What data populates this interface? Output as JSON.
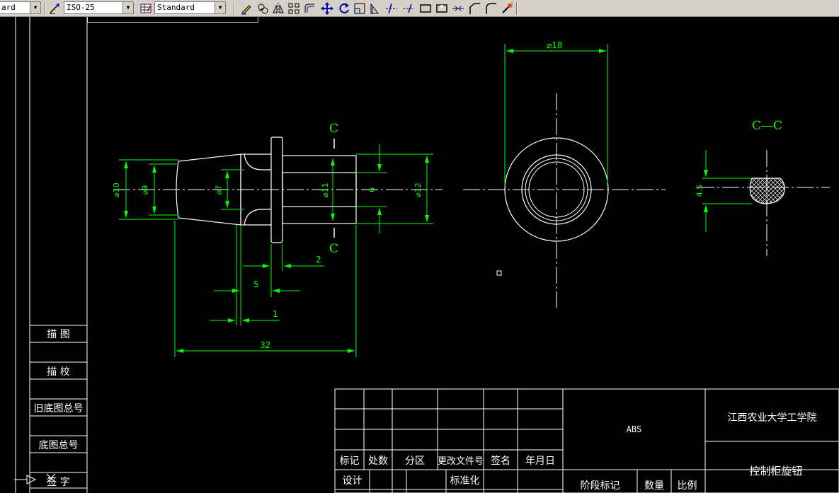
{
  "toolbar": {
    "text_style": "ard",
    "dim_style": "ISO-25",
    "table_style": "Standard",
    "icons": [
      "text-style-icon",
      "dim-style-icon",
      "table-style-icon",
      "pencil-icon",
      "layers-icon",
      "mirror-icon",
      "array-icon",
      "offset-icon",
      "move-icon",
      "rotate-icon",
      "scale-icon",
      "stretch-icon",
      "trim-icon",
      "extend-icon",
      "break-icon",
      "break-at-point-icon",
      "join-icon",
      "chamfer-icon",
      "fillet-icon",
      "explode-icon"
    ]
  },
  "colors": {
    "background": "#000000",
    "outline": "#ffffff",
    "dimension": "#00ff00",
    "section_label": "#00ff00",
    "centerline": "#ffffff"
  },
  "left_panel": {
    "labels": [
      "描  图",
      "描  校",
      "旧底图总号",
      "底图总号",
      "签  字"
    ]
  },
  "drawing": {
    "dimensions": {
      "overall_length": "32",
      "dia_10": "⌀10",
      "dia_9": "⌀9",
      "dia_7": "⌀7",
      "dia_11": "⌀11",
      "dim_6": "6",
      "dia_12": "⌀12",
      "dim_2": "2",
      "dim_5": "5",
      "dim_1": "1",
      "dia_18": "⌀18",
      "dim_45": "4.5"
    },
    "section_marker_top": "C",
    "section_marker_bottom": "C",
    "section_title": "C—C"
  },
  "title_block": {
    "material": "ABS",
    "school": "江西农业大学工学院",
    "part_name": "控制柜旋钮",
    "header_row": [
      "标记",
      "处数",
      "分区",
      "更改文件号",
      "签名",
      "年月日"
    ],
    "design": "设计",
    "standardize": "标准化",
    "stage_mark": "阶段标记",
    "quantity": "数量",
    "scale": "比例"
  }
}
